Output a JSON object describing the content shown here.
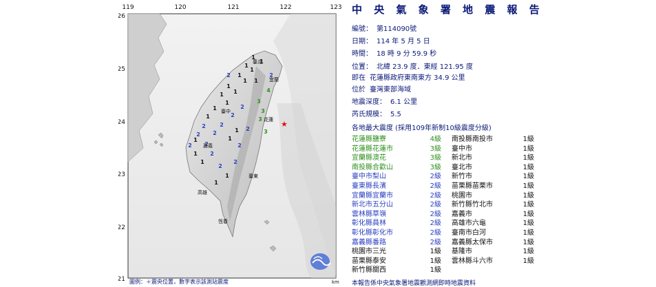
{
  "map": {
    "lon_ticks": [
      "119",
      "120",
      "121",
      "122",
      "123"
    ],
    "lat_ticks": [
      "26",
      "25",
      "24",
      "23",
      "22",
      "21"
    ],
    "scale_unit": "km",
    "epicenter_symbol": "★",
    "place_labels": {
      "taipei": "臺北",
      "yilan": "宜蘭",
      "taichung": "臺中",
      "hualien": "花蓮",
      "chiayi": "嘉義",
      "taitung": "臺東",
      "kaohsiung": "高雄",
      "hengchun": "恆春"
    },
    "intensity_marks": [
      {
        "t": "1",
        "c": "#111111"
      },
      {
        "t": "1",
        "c": "#111111"
      },
      {
        "t": "1",
        "c": "#111111"
      },
      {
        "t": "1",
        "c": "#111111"
      },
      {
        "t": "1",
        "c": "#111111"
      },
      {
        "t": "1",
        "c": "#111111"
      },
      {
        "t": "1",
        "c": "#111111"
      },
      {
        "t": "1",
        "c": "#111111"
      },
      {
        "t": "1",
        "c": "#111111"
      },
      {
        "t": "1",
        "c": "#111111"
      },
      {
        "t": "2",
        "c": "#2a3fc0"
      },
      {
        "t": "2",
        "c": "#2a3fc0"
      },
      {
        "t": "2",
        "c": "#2a3fc0"
      },
      {
        "t": "2",
        "c": "#2a3fc0"
      },
      {
        "t": "2",
        "c": "#2a3fc0"
      },
      {
        "t": "2",
        "c": "#2a3fc0"
      },
      {
        "t": "2",
        "c": "#2a3fc0"
      },
      {
        "t": "2",
        "c": "#2a3fc0"
      },
      {
        "t": "2",
        "c": "#2a3fc0"
      },
      {
        "t": "2",
        "c": "#2a3fc0"
      },
      {
        "t": "3",
        "c": "#2f8f1e"
      },
      {
        "t": "3",
        "c": "#2f8f1e"
      },
      {
        "t": "3",
        "c": "#2f8f1e"
      },
      {
        "t": "3",
        "c": "#2f8f1e"
      },
      {
        "t": "4",
        "c": "#2f8f1e"
      },
      {
        "t": "1",
        "c": "#111111"
      },
      {
        "t": "1",
        "c": "#111111"
      },
      {
        "t": "1",
        "c": "#111111"
      },
      {
        "t": "2",
        "c": "#2a3fc0"
      },
      {
        "t": "2",
        "c": "#2a3fc0"
      },
      {
        "t": "1",
        "c": "#111111"
      },
      {
        "t": "1",
        "c": "#111111"
      },
      {
        "t": "2",
        "c": "#2a3fc0"
      },
      {
        "t": "2",
        "c": "#2a3fc0"
      },
      {
        "t": "1",
        "c": "#111111"
      },
      {
        "t": "1",
        "c": "#111111"
      },
      {
        "t": "1",
        "c": "#111111"
      },
      {
        "t": "2",
        "c": "#2a3fc0"
      },
      {
        "t": "1",
        "c": "#111111"
      },
      {
        "t": "1",
        "c": "#111111"
      }
    ],
    "bottom_caption": "圖例：＋震央位置，數字表示該測站震度"
  },
  "report": {
    "title": "中 央 氣 象 署 地 震 報 告",
    "number_label": "編號：",
    "number_value": "第114090號",
    "date_label": "日期：",
    "date_value": "114  年  5  月  5  日",
    "time_label": "時間：",
    "time_value": "18  時  9  分  59.9  秒",
    "position_label": "位置：",
    "position_value": "北緯  23.9  度．東經  121.95  度",
    "reference_label": "即在",
    "reference_value": "花蓮縣政府東南東方  34.9  公里",
    "region_label": "位於",
    "region_value": "臺灣東部海域",
    "depth_label": "地震深度：",
    "depth_value": "6.1  公里",
    "magnitude_label": "芮氏規模：",
    "magnitude_value": "5.5",
    "intensity_header": "各地最大震度 (採用109年新制10級震度分級)",
    "left_list": [
      {
        "loc": "花蓮縣鹽寮",
        "lv": "4級",
        "color": "#2f8f1e"
      },
      {
        "loc": "花蓮縣花蓮市",
        "lv": "3級",
        "color": "#2f8f1e"
      },
      {
        "loc": "宜蘭縣澳花",
        "lv": "3級",
        "color": "#2f8f1e"
      },
      {
        "loc": "南投縣合歡山",
        "lv": "3級",
        "color": "#2f8f1e"
      },
      {
        "loc": "臺中市梨山",
        "lv": "2級",
        "color": "#2a3fc0"
      },
      {
        "loc": "臺東縣長濱",
        "lv": "2級",
        "color": "#2a3fc0"
      },
      {
        "loc": "宜蘭縣宜蘭市",
        "lv": "2級",
        "color": "#2a3fc0"
      },
      {
        "loc": "新北市五分山",
        "lv": "2級",
        "color": "#2a3fc0"
      },
      {
        "loc": "雲林縣草嶺",
        "lv": "2級",
        "color": "#2a3fc0"
      },
      {
        "loc": "彰化縣員林",
        "lv": "2級",
        "color": "#2a3fc0"
      },
      {
        "loc": "彰化縣彰化市",
        "lv": "2級",
        "color": "#2a3fc0"
      },
      {
        "loc": "嘉義縣番路",
        "lv": "2級",
        "color": "#2a3fc0"
      },
      {
        "loc": "桃園市三光",
        "lv": "1級",
        "color": "#111111"
      },
      {
        "loc": "苗栗縣泰安",
        "lv": "1級",
        "color": "#111111"
      },
      {
        "loc": "新竹縣關西",
        "lv": "1級",
        "color": "#111111"
      }
    ],
    "right_list": [
      {
        "loc": "南投縣南投市",
        "lv": "1級",
        "color": "#111111"
      },
      {
        "loc": "臺中市",
        "lv": "1級",
        "color": "#111111"
      },
      {
        "loc": "新北市",
        "lv": "1級",
        "color": "#111111"
      },
      {
        "loc": "臺北市",
        "lv": "1級",
        "color": "#111111"
      },
      {
        "loc": "新竹市",
        "lv": "1級",
        "color": "#111111"
      },
      {
        "loc": "苗栗縣苗栗市",
        "lv": "1級",
        "color": "#111111"
      },
      {
        "loc": "桃園市",
        "lv": "1級",
        "color": "#111111"
      },
      {
        "loc": "新竹縣竹北市",
        "lv": "1級",
        "color": "#111111"
      },
      {
        "loc": "嘉義市",
        "lv": "1級",
        "color": "#111111"
      },
      {
        "loc": "高雄市六龜",
        "lv": "1級",
        "color": "#111111"
      },
      {
        "loc": "臺南市白河",
        "lv": "1級",
        "color": "#111111"
      },
      {
        "loc": "嘉義縣太保市",
        "lv": "1級",
        "color": "#111111"
      },
      {
        "loc": "基隆市",
        "lv": "1級",
        "color": "#111111"
      },
      {
        "loc": "雲林縣斗六市",
        "lv": "1級",
        "color": "#111111"
      }
    ],
    "footer": "本報告係中央氣象署地震觀測網即時地震資料"
  }
}
